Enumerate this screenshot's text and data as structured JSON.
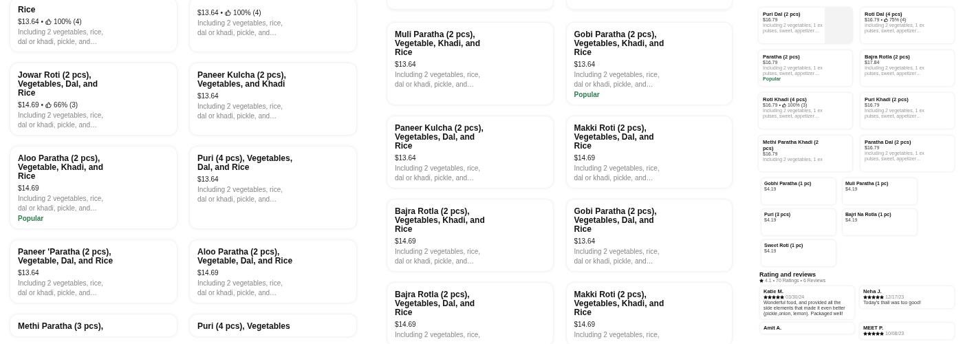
{
  "menu_left": {
    "rows": [
      [
        {
          "title": "Rice",
          "price": "$13.64",
          "separator": "•",
          "rating": "100% (4)",
          "description": "Including 2 vegetables, rice, dal or khadi, pickle, and…"
        },
        {
          "price": "$13.64",
          "separator": "•",
          "rating": "100% (4)",
          "description": "Including 2 vegetables, rice, dal or khadi, pickle, and…"
        }
      ],
      [
        {
          "title": "Jowar Roti (2 pcs), Vegetables, Dal, and Rice",
          "price": "$14.69",
          "separator": "•",
          "rating": "66% (3)",
          "description": "Including 2 vegetables, rice, dal or khadi, pickle, and…"
        },
        {
          "title": "Paneer Kulcha (2 pcs), Vegetables, and Khadi",
          "price": "$13.64",
          "description": "Including 2 vegetables, rice, dal or khadi, pickle, and…"
        }
      ],
      [
        {
          "title": "Aloo Paratha (2 pcs), Vegetable, Khadi, and Rice",
          "price": "$14.69",
          "description": "Including 2 vegetables, rice, dal or khadi, pickle, and…",
          "badge": "Popular"
        },
        {
          "title": "Puri (4 pcs), Vegetables, Dal, and Rice",
          "price": "$13.64",
          "description": "Including 2 vegetables, rice, dal or khadi, pickle, and…"
        }
      ],
      [
        {
          "title": "Paneer 'Paratha (2 pcs), Vegetable, Dal, and Rice",
          "price": "$13.64",
          "description": "Including 2 vegetables, rice, dal or khadi, pickle, and…"
        },
        {
          "title": "Aloo Paratha (2 pcs), Vegetable, Dal, and Rice",
          "price": "$14.69",
          "description": "Including 2 vegetables, rice, dal or khadi, pickle, and…"
        }
      ],
      [
        {
          "title": "Methi Paratha (3 pcs),"
        },
        {
          "title": "Puri (4 pcs), Vegetables"
        }
      ]
    ]
  },
  "menu_middle": {
    "rows": [
      [
        {
          "title": "Muli Paratha (2 pcs), Vegetable, Khadi, and Rice",
          "price": "$13.64",
          "description": "Including 2 vegetables, rice, dal or khadi, pickle, and…"
        },
        {
          "title": "Gobi Paratha (2 pcs), Vegetables, Khadi, and Rice",
          "price": "$13.64",
          "description": "Including 2 vegetables, rice, dal or khadi, pickle, and…",
          "badge": "Popular"
        }
      ],
      [
        {
          "title": "Paneer Kulcha (2 pcs), Vegetables, Dal, and Rice",
          "price": "$13.64",
          "description": "Including 2 vegetables, rice, dal or khadi, pickle, and…"
        },
        {
          "title": "Makki Roti (2 pcs), Vegetables, Dal, and Rice",
          "price": "$14.69",
          "description": "Including 2 vegetables, rice, dal or khadi, pickle, and…"
        }
      ],
      [
        {
          "title": "Bajra Rotla (2 pcs), Vegetables, Khadi, and Rice",
          "price": "$14.69",
          "description": "Including 2 vegetables, rice, dal or khadi, pickle, and…"
        },
        {
          "title": "Gobi Paratha (2 pcs), Vegetables, Dal, and Rice",
          "price": "$13.64",
          "description": "Including 2 vegetables, rice, dal or khadi, pickle, and…"
        }
      ],
      [
        {
          "title": "Bajra Rotla (2 pcs), Vegetables, Dal, and Rice",
          "price": "$14.69",
          "description": "Including 2 vegetables, rice,"
        },
        {
          "title": "Makki Roti (2 pcs), Vegetables, Khadi, and Rice",
          "price": "$14.69",
          "description": "Including 2 vegetables, rice,"
        }
      ]
    ]
  },
  "menu_right": {
    "rows": [
      [
        {
          "title": "Puri Dal (2 pcs)",
          "price": "$16.79",
          "description": "Including 2 vegetables, 1 ex pulses, sweet, appetizer…",
          "image": true
        },
        {
          "title": "Roti Dal (4 pcs)",
          "price": "$16.79",
          "separator": "•",
          "rating": "75% (4)",
          "description": "Including 2 vegetables, 1 ex pulses, sweet, appetizer…",
          "image": false
        }
      ],
      [
        {
          "title": "Paratha (2 pcs)",
          "price": "$16.79",
          "description": "Including 2 vegetables, 1 ex pulses, sweet, appetizer…",
          "badge": "Popular",
          "image": false
        },
        {
          "title": "Bajra Rotla (2 pcs)",
          "price": "$17.84",
          "description": "Including 2 vegetables, 1 ex pulses, sweet, appetizer…",
          "image": false
        }
      ],
      [
        {
          "title": "Roti Khadi (4 pcs)",
          "price": "$16.79",
          "separator": "•",
          "rating": "100% (3)",
          "description": "Including 2 vegetables, 1 ex pulses, sweet, appetizer…",
          "image": false
        },
        {
          "title": "Puri Khadi (2 pcs)",
          "price": "$16.79",
          "description": "Including 2 vegetables, 1 ex pulses, sweet, appetizer…",
          "image": false
        }
      ],
      [
        {
          "title": "Methi Paratha Khadi (2 pcs)",
          "price": "$16.79",
          "description": "Including 2 vegetables, 1 ex",
          "image": false
        },
        {
          "title": "Paratha Dal (2 pcs)",
          "price": "$16.79",
          "description": "Including 2 vegetables, 1 ex pulses, sweet, appetizer…",
          "image": false
        }
      ]
    ],
    "small_items": [
      {
        "title": "Gobhi Paratha (1 pc)",
        "price": "$4.19"
      },
      {
        "title": "Muli Paratha (1 pc)",
        "price": "$4.19"
      },
      {
        "title": "Puri (3 pcs)",
        "price": "$4.19"
      },
      {
        "title": "Bajri Na Rotla (1 pc)",
        "price": "$4.19"
      },
      {
        "title": "Sweet Roti (1 pc)",
        "price": "$4.19"
      }
    ],
    "reviews_title": "Rating and reviews",
    "reviews_summary": "4.1 • 70 Ratings • 6 Reviews",
    "reviews": [
      {
        "name": "Katie M.",
        "stars": 5,
        "date": "03/30/24",
        "text": "Wonderful food, and provided all the side elements that made it even better (pickle,onion, lemon). Packaged well!"
      },
      {
        "name": "Neha J.",
        "stars": 5,
        "date": "12/17/23",
        "text": "Today's thali was too good!"
      },
      {
        "name": "Amit A."
      },
      {
        "name": "MEET P.",
        "stars": 5,
        "date": "10/08/23"
      }
    ]
  }
}
